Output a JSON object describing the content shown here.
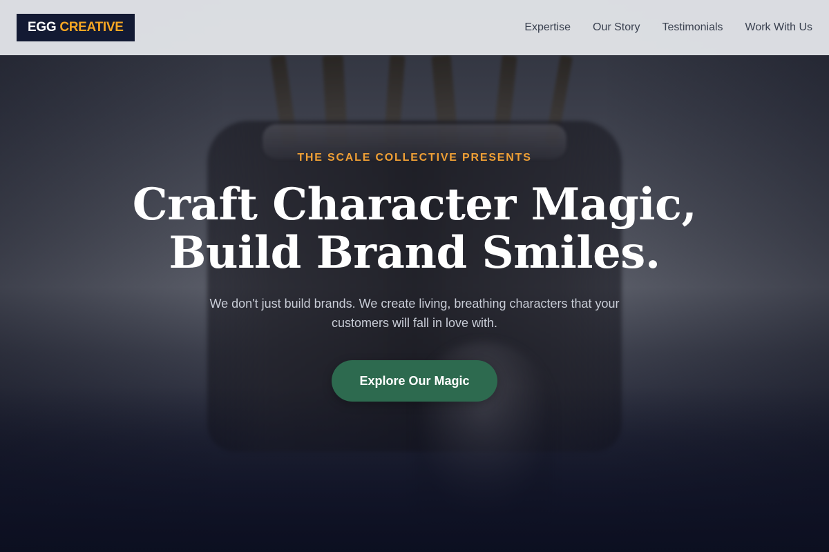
{
  "header": {
    "logo": {
      "part1": "EGG",
      "part2": "CREATIVE"
    },
    "nav": [
      {
        "label": "Expertise"
      },
      {
        "label": "Our Story"
      },
      {
        "label": "Testimonials"
      },
      {
        "label": "Work With Us"
      }
    ]
  },
  "hero": {
    "eyebrow": "THE SCALE COLLECTIVE PRESENTS",
    "headline_line1": "Craft Character Magic,",
    "headline_line2": "Build Brand Smiles.",
    "subtext": "We don't just build brands. We create living, breathing characters that your customers will fall in love with.",
    "cta_label": "Explore Our Magic"
  },
  "colors": {
    "header_bg": "#e2e4e8",
    "logo_bg": "#131a33",
    "accent_orange": "#f5a623",
    "cta_green": "#2d6a4f",
    "nav_text": "#3a4150"
  }
}
